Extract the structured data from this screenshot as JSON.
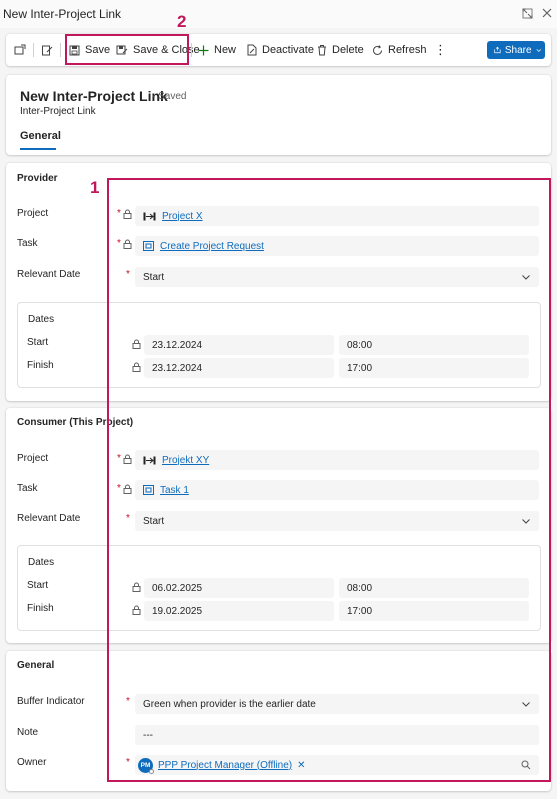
{
  "window": {
    "title": "New Inter-Project Link"
  },
  "commands": {
    "save": "Save",
    "save_close": "Save & Close",
    "new": "New",
    "deactivate": "Deactivate",
    "delete": "Delete",
    "refresh": "Refresh",
    "share": "Share"
  },
  "header": {
    "title": "New Inter-Project Link",
    "status": "- Saved",
    "entity": "Inter-Project Link",
    "tab": "General"
  },
  "provider": {
    "section_title": "Provider",
    "project_label": "Project",
    "project_value": "Project X",
    "task_label": "Task",
    "task_value": "Create Project Request",
    "relevant_date_label": "Relevant Date",
    "relevant_date_value": "Start",
    "dates_title": "Dates",
    "start_label": "Start",
    "start_date": "23.12.2024",
    "start_time": "08:00",
    "finish_label": "Finish",
    "finish_date": "23.12.2024",
    "finish_time": "17:00"
  },
  "consumer": {
    "section_title": "Consumer (This Project)",
    "project_label": "Project",
    "project_value": "Projekt XY",
    "task_label": "Task",
    "task_value": "Task 1",
    "relevant_date_label": "Relevant Date",
    "relevant_date_value": "Start",
    "dates_title": "Dates",
    "start_label": "Start",
    "start_date": "06.02.2025",
    "start_time": "08:00",
    "finish_label": "Finish",
    "finish_date": "19.02.2025",
    "finish_time": "17:00"
  },
  "general": {
    "section_title": "General",
    "buffer_label": "Buffer Indicator",
    "buffer_value": "Green when provider is the earlier date",
    "note_label": "Note",
    "note_value": "---",
    "owner_label": "Owner",
    "owner_initials": "PM",
    "owner_value": "PPP Project Manager (Offline)"
  },
  "annotations": {
    "box1": "1",
    "box2": "2"
  },
  "colors": {
    "accent": "#0f6cbd",
    "required": "#c50f1f",
    "annotation": "#c2185b"
  }
}
